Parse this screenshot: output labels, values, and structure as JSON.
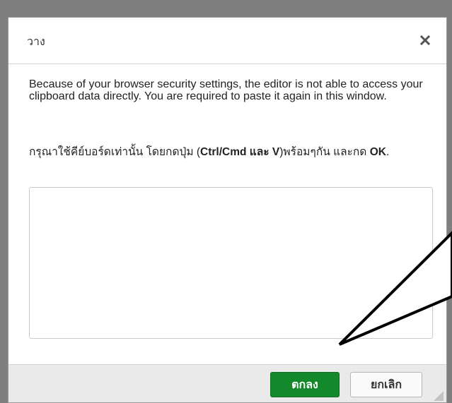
{
  "dialog": {
    "title": "วาง",
    "close_icon": "close-icon",
    "info_text": "Because of your browser security settings, the editor is not able to access your clipboard data directly. You are required to paste it again in this window.",
    "instruction": {
      "part1": "กรุณาใช้คีย์บอร์ดเท่านั้น โดยกดปุ่ม (",
      "keys": "Ctrl/Cmd และ V",
      "part2": ")พร้อมๆกัน และกด ",
      "ok_word": "OK",
      "part3": "."
    },
    "paste_area": {
      "value": ""
    },
    "footer": {
      "ok_label": "ตกลง",
      "cancel_label": "ยกเลิก"
    }
  },
  "colors": {
    "ok_button": "#14892c",
    "backdrop": "#7f7f7f",
    "footer": "#eaeaea"
  }
}
